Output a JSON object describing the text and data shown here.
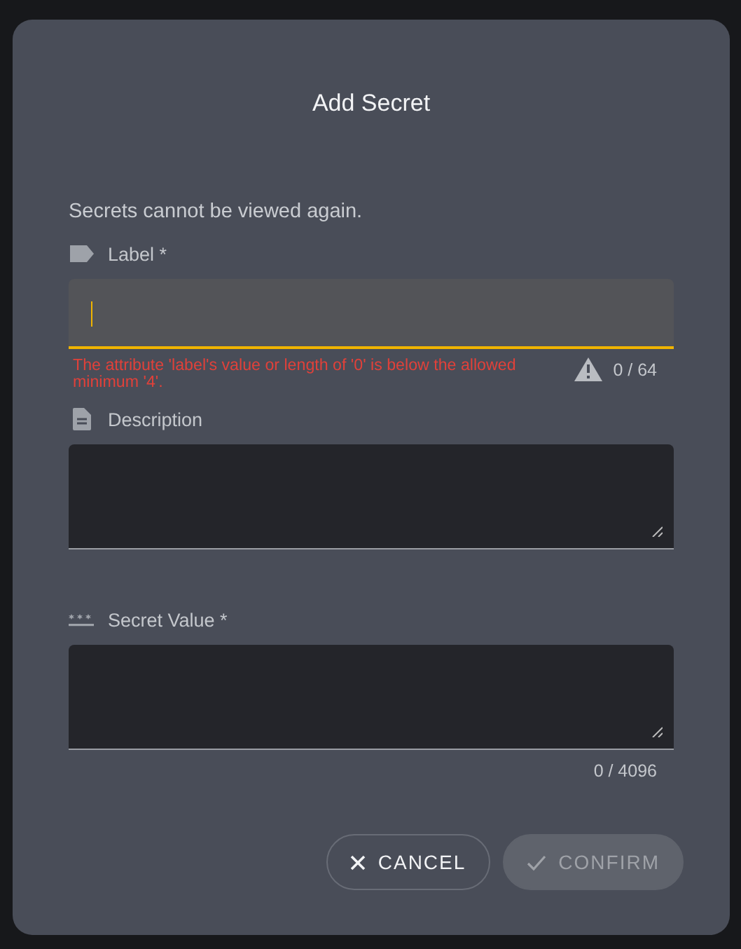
{
  "dialog": {
    "title": "Add Secret",
    "notice": "Secrets cannot be viewed again.",
    "fields": [
      {
        "kind": "label",
        "label": "Label *",
        "focused": true,
        "error": "The attribute 'label's value or length of '0' is below the allowed minimum '4'.",
        "counter": "0 / 64"
      },
      {
        "kind": "description",
        "label": "Description",
        "focused": false
      },
      {
        "kind": "secret",
        "label": "Secret Value *",
        "focused": false,
        "counter": "0 / 4096"
      }
    ],
    "buttons": [
      {
        "kind": "cancel",
        "label": "CANCEL",
        "disabled": false
      },
      {
        "kind": "confirm",
        "label": "CONFIRM",
        "disabled": true
      }
    ]
  }
}
